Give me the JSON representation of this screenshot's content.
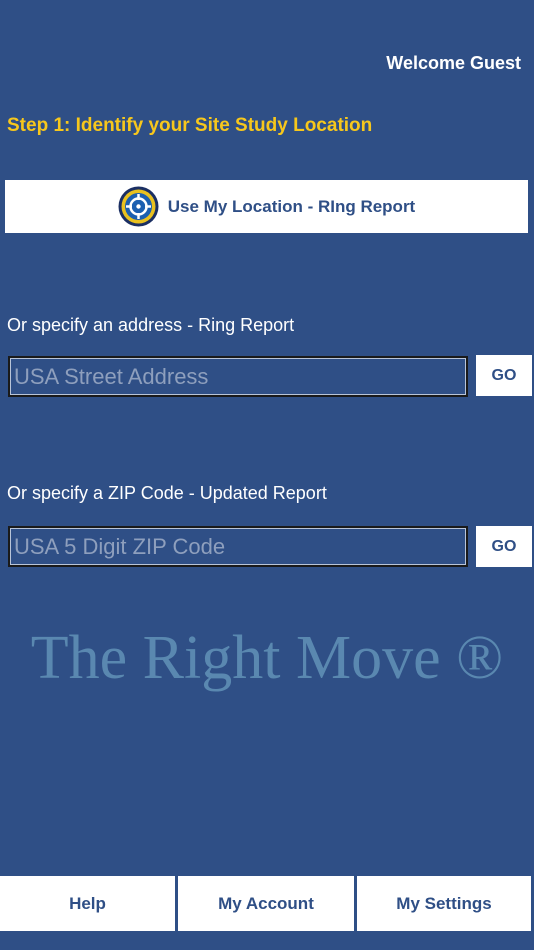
{
  "header": {
    "welcome_text": "Welcome Guest"
  },
  "step": {
    "title": "Step 1: Identify your Site Study Location"
  },
  "location_button": {
    "icon": "target-location-icon",
    "label": "Use My Location - RIng Report"
  },
  "address_section": {
    "label": "Or specify an address - Ring Report",
    "input_value": "",
    "placeholder": "USA Street Address",
    "go_label": "GO"
  },
  "zip_section": {
    "label": "Or specify a ZIP Code - Updated Report",
    "input_value": "",
    "placeholder": "USA 5 Digit ZIP Code",
    "go_label": "GO"
  },
  "brand": {
    "text": "The Right Move ®"
  },
  "tabs": [
    {
      "label": "Help"
    },
    {
      "label": "My Account"
    },
    {
      "label": "My Settings"
    }
  ],
  "colors": {
    "background": "#2f4f86",
    "accent_yellow": "#f7c71c",
    "button_text": "#2f4f86",
    "brand_text": "#5a88b0"
  }
}
